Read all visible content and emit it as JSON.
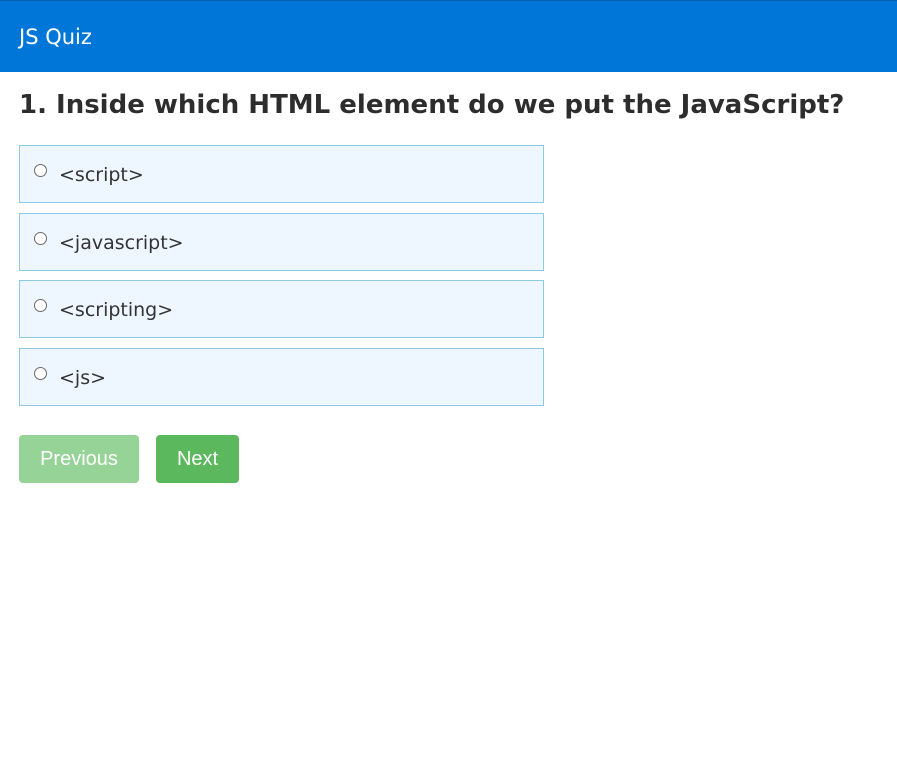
{
  "header": {
    "title": "JS Quiz",
    "background_color": "#0077d8"
  },
  "question": {
    "text": "1. Inside which HTML element do we put the JavaScript?"
  },
  "options": [
    {
      "label": "<script>",
      "selected": false
    },
    {
      "label": "<javascript>",
      "selected": false
    },
    {
      "label": "<scripting>",
      "selected": false
    },
    {
      "label": "<js>",
      "selected": false
    }
  ],
  "buttons": {
    "previous_label": "Previous",
    "next_label": "Next",
    "previous_disabled": true
  },
  "colors": {
    "option_background": "#eef7ff",
    "option_border": "#8cc8e8",
    "next_button": "#5cb85c",
    "previous_button_disabled": "#96d396"
  }
}
